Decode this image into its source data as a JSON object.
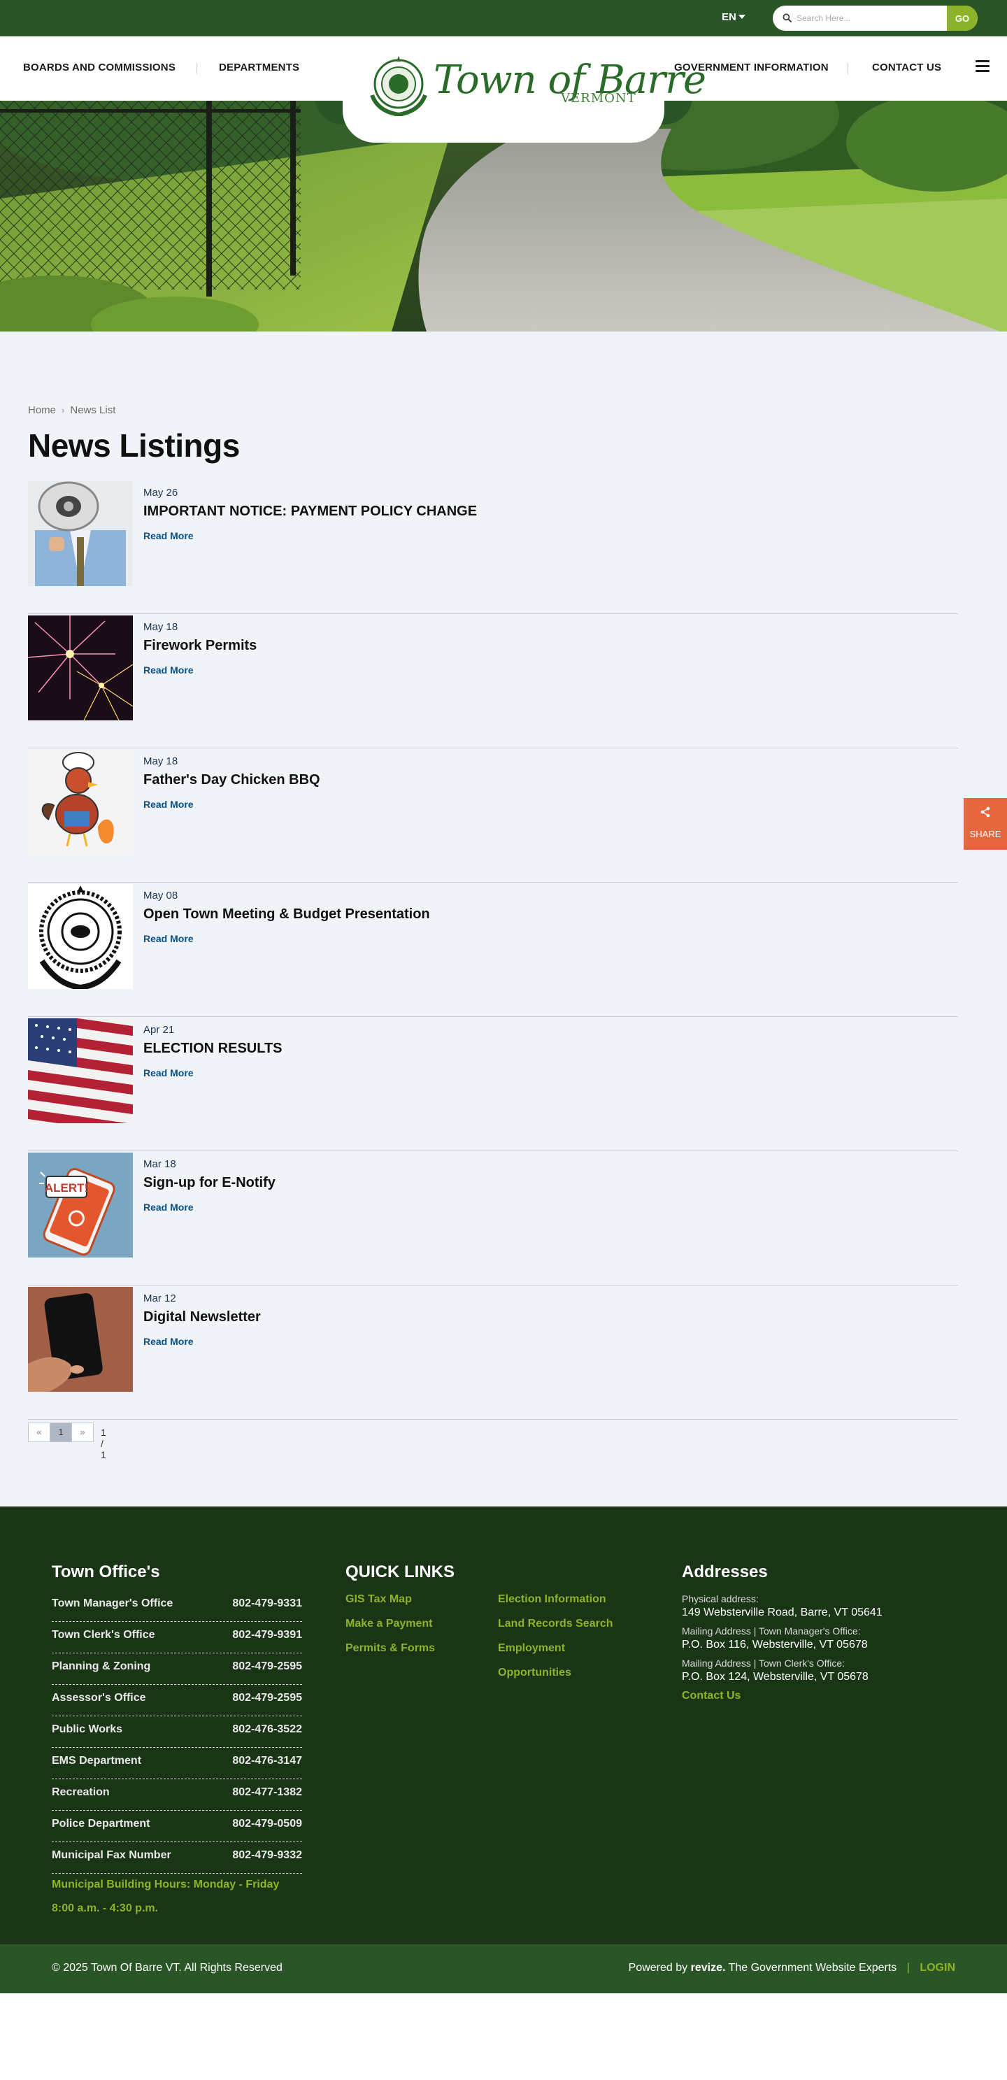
{
  "topbar": {
    "language": "EN",
    "search_placeholder": "Search Here...",
    "search_button": "GO"
  },
  "nav": {
    "left": [
      "BOARDS AND COMMISSIONS",
      "DEPARTMENTS"
    ],
    "right": [
      "GOVERNMENT INFORMATION",
      "CONTACT US"
    ]
  },
  "logo": {
    "title": "Town of Barre",
    "subtitle": "VERMONT"
  },
  "breadcrumb": {
    "home": "Home",
    "current": "News List"
  },
  "page_title": "News Listings",
  "news": [
    {
      "date": "May 26",
      "title": "IMPORTANT NOTICE: PAYMENT POLICY CHANGE",
      "read_more": "Read More",
      "image": "megaphone-man"
    },
    {
      "date": "May 18",
      "title": "Firework Permits",
      "read_more": "Read More",
      "image": "fireworks"
    },
    {
      "date": "May 18",
      "title": "Father's Day Chicken BBQ",
      "read_more": "Read More",
      "image": "chef-chicken"
    },
    {
      "date": "May 08",
      "title": "Open Town Meeting & Budget Presentation",
      "read_more": "Read More",
      "image": "town-seal"
    },
    {
      "date": "Apr 21",
      "title": "ELECTION RESULTS",
      "read_more": "Read More",
      "image": "american-flag"
    },
    {
      "date": "Mar 18",
      "title": "Sign-up for E-Notify",
      "read_more": "Read More",
      "image": "alert-phone",
      "alert_text": "ALERT!"
    },
    {
      "date": "Mar 12",
      "title": "Digital Newsletter",
      "read_more": "Read More",
      "image": "hand-phone"
    }
  ],
  "pager": {
    "prev": "«",
    "page": "1",
    "next": "»",
    "info": "1 / 1"
  },
  "share": {
    "label": "SHARE"
  },
  "footer": {
    "offices_title": "Town Office's",
    "offices": [
      {
        "name": "Town Manager's Office",
        "phone": "802-479-9331"
      },
      {
        "name": "Town Clerk's Office",
        "phone": "802-479-9391"
      },
      {
        "name": "Planning & Zoning",
        "phone": "802-479-2595"
      },
      {
        "name": "Assessor's Office",
        "phone": "802-479-2595"
      },
      {
        "name": "Public Works",
        "phone": "802-476-3522"
      },
      {
        "name": "EMS Department",
        "phone": "802-476-3147"
      },
      {
        "name": "Recreation",
        "phone": "802-477-1382"
      },
      {
        "name": "Police Department",
        "phone": "802-479-0509"
      },
      {
        "name": "Municipal Fax Number",
        "phone": "802-479-9332"
      }
    ],
    "hours_line1": "Municipal Building Hours:  Monday - Friday",
    "hours_line2": "8:00 a.m. - 4:30 p.m.",
    "quick_links_title": "QUICK LINKS",
    "quick_links_col1": [
      "GIS Tax Map",
      "Make a Payment",
      "Permits & Forms"
    ],
    "quick_links_col2": [
      "Election Information",
      "Land Records Search",
      "Employment",
      "Opportunities"
    ],
    "addresses_title": "Addresses",
    "physical_label": "Physical address:",
    "physical_value": "149 Websterville Road, Barre, VT 05641",
    "mailing_manager_label": "Mailing Address | Town Manager's Office:",
    "mailing_manager_value": "P.O. Box 116, Websterville, VT 05678",
    "mailing_clerk_label": "Mailing Address | Town Clerk's Office:",
    "mailing_clerk_value": "P.O. Box 124, Websterville, VT 05678",
    "contact_link": "Contact Us"
  },
  "bottombar": {
    "copyright": "© 2025 Town Of Barre VT. All Rights Reserved",
    "powered_prefix": "Powered by",
    "powered_brand": "revize.",
    "powered_suffix": "The Government Website Experts",
    "divider": "|",
    "login": "LOGIN"
  },
  "colors": {
    "brand_green": "#2a5526",
    "footer_green": "#1a3516",
    "accent_lime": "#8db32b",
    "link_blue": "#0b4f85",
    "share_orange": "#e8663d",
    "content_bg": "#f0f3f7"
  }
}
